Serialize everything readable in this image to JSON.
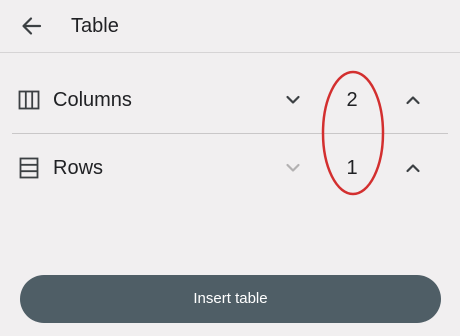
{
  "header": {
    "title": "Table",
    "back_icon": "arrow-back-icon"
  },
  "rows": [
    {
      "label": "Columns",
      "icon": "view-column-icon",
      "value": "2",
      "decrement_icon": "chevron-down-icon",
      "increment_icon": "chevron-up-icon",
      "decrement_enabled": true
    },
    {
      "label": "Rows",
      "icon": "table-rows-icon",
      "value": "1",
      "decrement_icon": "chevron-down-icon",
      "increment_icon": "chevron-up-icon",
      "decrement_enabled": false
    }
  ],
  "actions": {
    "insert_label": "Insert table"
  },
  "colors": {
    "background": "#f1eff0",
    "primary_button": "#4f5e66",
    "annotation": "#d32f2f",
    "icon": "#3c4043",
    "icon_disabled": "#b3b1b2"
  }
}
